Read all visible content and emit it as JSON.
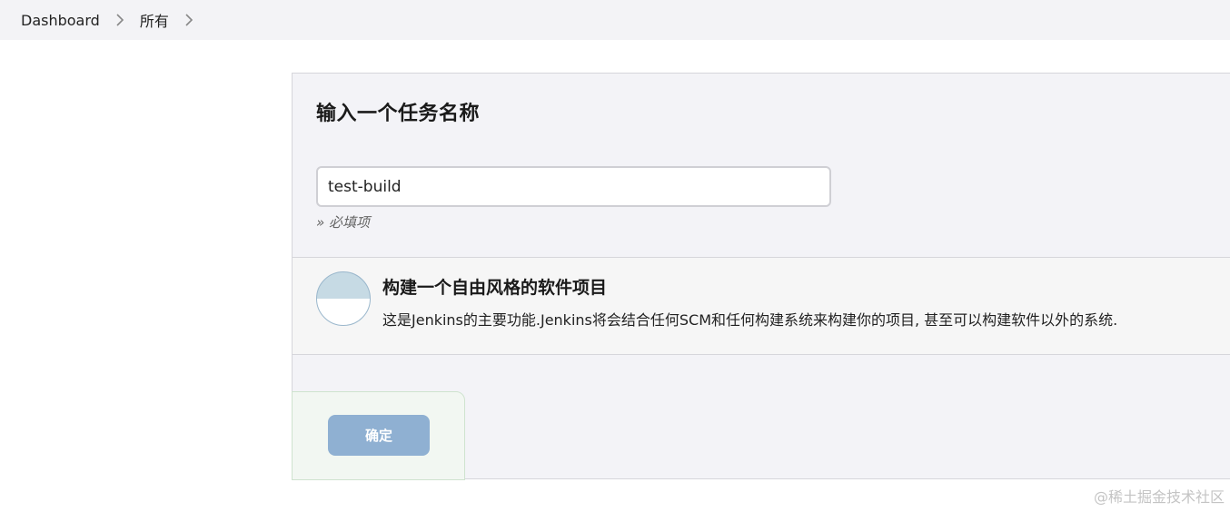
{
  "breadcrumb": {
    "items": [
      "Dashboard",
      "所有"
    ]
  },
  "form": {
    "title": "输入一个任务名称",
    "name_value": "test-build",
    "required_hint": "» 必填项"
  },
  "item_types": [
    {
      "title": "构建一个自由风格的软件项目",
      "description": "这是Jenkins的主要功能.Jenkins将会结合任何SCM和任何构建系统来构建你的项目, 甚至可以构建软件以外的系统.",
      "icon": "freestyle-project-icon"
    }
  ],
  "actions": {
    "ok_label": "确定"
  },
  "watermark": "@稀土掘金技术社区",
  "colors": {
    "panel_bg": "#f3f3f7",
    "ok_button": "#8fb0d2",
    "breadcrumb_bg": "#f3f3f6"
  }
}
